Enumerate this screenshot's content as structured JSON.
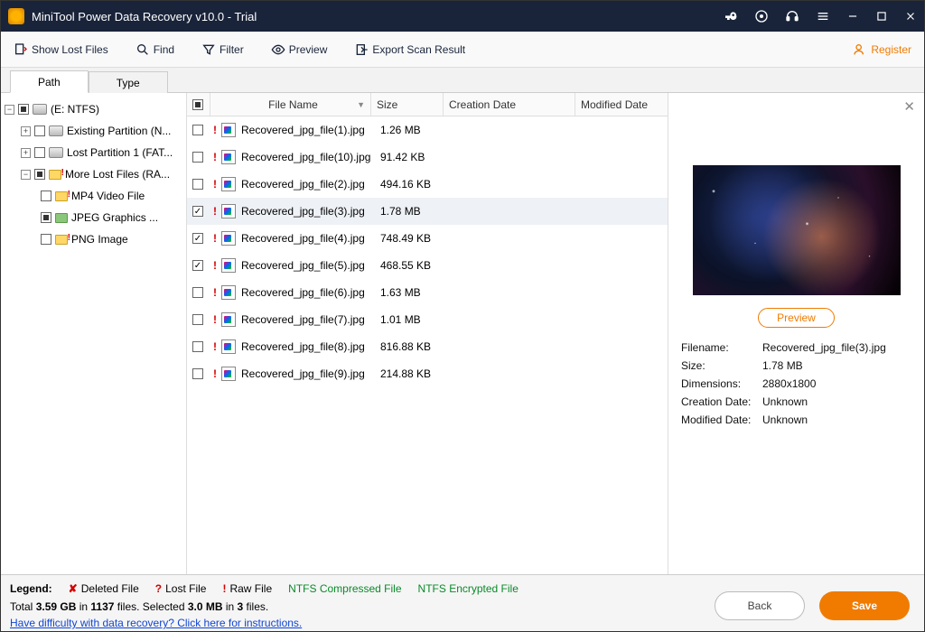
{
  "titlebar": {
    "title": "MiniTool Power Data Recovery v10.0 - Trial"
  },
  "toolbar": {
    "show_lost": "Show Lost Files",
    "find": "Find",
    "filter": "Filter",
    "preview": "Preview",
    "export": "Export Scan Result",
    "register": "Register"
  },
  "tabs": {
    "path": "Path",
    "type": "Type"
  },
  "tree": {
    "root": "(E: NTFS)",
    "existing": "Existing Partition (N...",
    "lost": "Lost Partition 1 (FAT...",
    "more": "More Lost Files (RA...",
    "mp4": "MP4 Video File",
    "jpeg": "JPEG Graphics ...",
    "png": "PNG Image"
  },
  "cols": {
    "name": "File Name",
    "size": "Size",
    "cdate": "Creation Date",
    "mdate": "Modified Date"
  },
  "files": [
    {
      "name": "Recovered_jpg_file(1).jpg",
      "size": "1.26 MB",
      "checked": false,
      "selected": false
    },
    {
      "name": "Recovered_jpg_file(10).jpg",
      "size": "91.42 KB",
      "checked": false,
      "selected": false
    },
    {
      "name": "Recovered_jpg_file(2).jpg",
      "size": "494.16 KB",
      "checked": false,
      "selected": false
    },
    {
      "name": "Recovered_jpg_file(3).jpg",
      "size": "1.78 MB",
      "checked": true,
      "selected": true
    },
    {
      "name": "Recovered_jpg_file(4).jpg",
      "size": "748.49 KB",
      "checked": true,
      "selected": false
    },
    {
      "name": "Recovered_jpg_file(5).jpg",
      "size": "468.55 KB",
      "checked": true,
      "selected": false
    },
    {
      "name": "Recovered_jpg_file(6).jpg",
      "size": "1.63 MB",
      "checked": false,
      "selected": false
    },
    {
      "name": "Recovered_jpg_file(7).jpg",
      "size": "1.01 MB",
      "checked": false,
      "selected": false
    },
    {
      "name": "Recovered_jpg_file(8).jpg",
      "size": "816.88 KB",
      "checked": false,
      "selected": false
    },
    {
      "name": "Recovered_jpg_file(9).jpg",
      "size": "214.88 KB",
      "checked": false,
      "selected": false
    }
  ],
  "preview": {
    "button": "Preview",
    "filename_k": "Filename:",
    "filename_v": "Recovered_jpg_file(3).jpg",
    "size_k": "Size:",
    "size_v": "1.78 MB",
    "dim_k": "Dimensions:",
    "dim_v": "2880x1800",
    "cdate_k": "Creation Date:",
    "cdate_v": "Unknown",
    "mdate_k": "Modified Date:",
    "mdate_v": "Unknown"
  },
  "legend": {
    "label": "Legend:",
    "deleted": "Deleted File",
    "lost": "Lost File",
    "raw": "Raw File",
    "ntfs_comp": "NTFS Compressed File",
    "ntfs_enc": "NTFS Encrypted File"
  },
  "stats": {
    "prefix": "Total ",
    "total_size": "3.59 GB",
    "in": " in ",
    "total_files": "1137",
    "files_txt": " files.  Selected ",
    "sel_size": "3.0 MB",
    "sel_files": "3",
    "suffix": " files."
  },
  "help": "Have difficulty with data recovery? Click here for instructions.",
  "buttons": {
    "back": "Back",
    "save": "Save"
  }
}
